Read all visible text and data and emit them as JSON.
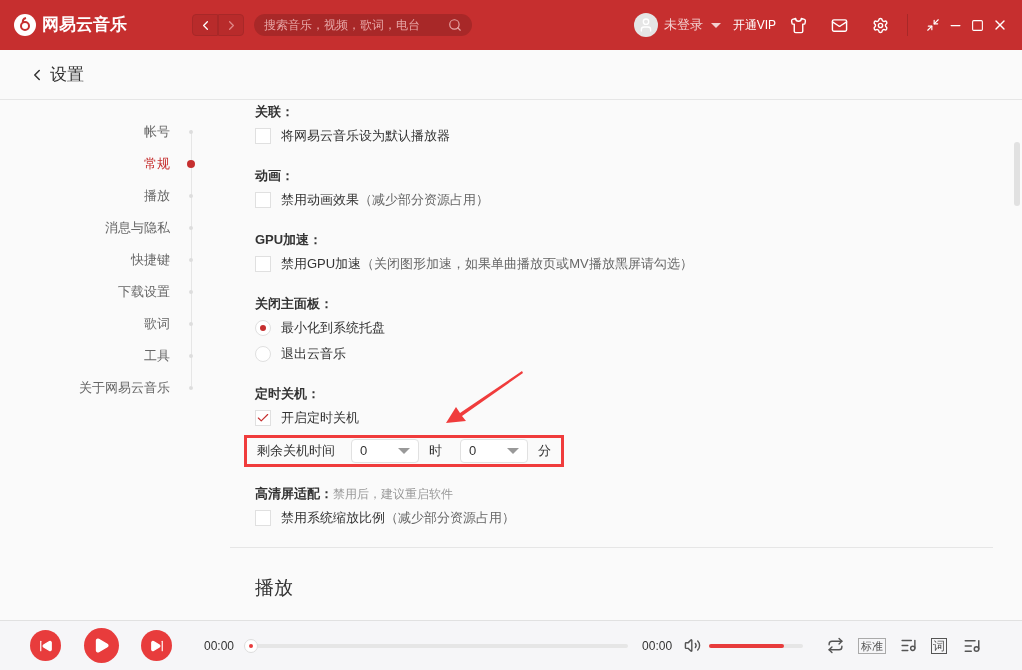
{
  "app": {
    "name": "网易云音乐"
  },
  "search": {
    "placeholder": "搜索音乐，视频，歌词，电台"
  },
  "user": {
    "name": "未登录"
  },
  "vip": "开通VIP",
  "page": {
    "title": "设置"
  },
  "nav": [
    {
      "label": "帐号",
      "selected": false
    },
    {
      "label": "常规",
      "selected": true
    },
    {
      "label": "播放",
      "selected": false
    },
    {
      "label": "消息与隐私",
      "selected": false
    },
    {
      "label": "快捷键",
      "selected": false
    },
    {
      "label": "下载设置",
      "selected": false
    },
    {
      "label": "歌词",
      "selected": false
    },
    {
      "label": "工具",
      "selected": false
    },
    {
      "label": "关于网易云音乐",
      "selected": false
    }
  ],
  "sections": [
    {
      "title": "关联：",
      "options": [
        {
          "kind": "checkbox",
          "label": "将网易云音乐设为默认播放器",
          "checked": false
        }
      ]
    },
    {
      "title": "动画：",
      "options": [
        {
          "kind": "checkbox",
          "label": "禁用动画效果",
          "note": "（减少部分资源占用）",
          "checked": false
        }
      ]
    },
    {
      "title": "GPU加速：",
      "options": [
        {
          "kind": "checkbox",
          "label": "禁用GPU加速",
          "note": "（关闭图形加速，如果单曲播放页或MV播放黑屏请勾选）",
          "checked": false
        }
      ]
    },
    {
      "title": "关闭主面板：",
      "options": [
        {
          "kind": "radio",
          "label": "最小化到系统托盘",
          "selected": true
        },
        {
          "kind": "radio",
          "label": "退出云音乐",
          "selected": false
        }
      ]
    },
    {
      "title": "定时关机：",
      "options": [
        {
          "kind": "checkbox",
          "label": "开启定时关机",
          "checked": true
        },
        {
          "kind": "timer",
          "label": "剩余关机时间",
          "hours": "0",
          "hours_unit": "时",
          "minutes": "0",
          "minutes_unit": "分",
          "highlighted": true
        }
      ]
    },
    {
      "title": "高清屏适配：",
      "note": "禁用后，建议重启软件",
      "options": [
        {
          "kind": "checkbox",
          "label": "禁用系统缩放比例",
          "note": "（减少部分资源占用）",
          "checked": false
        }
      ]
    }
  ],
  "next_section": "播放",
  "player": {
    "elapsed": "00:00",
    "total": "00:00",
    "progress": {
      "level": 0
    },
    "volume": {
      "level": 0.8
    },
    "quality": "标准",
    "lyrics": "词"
  }
}
